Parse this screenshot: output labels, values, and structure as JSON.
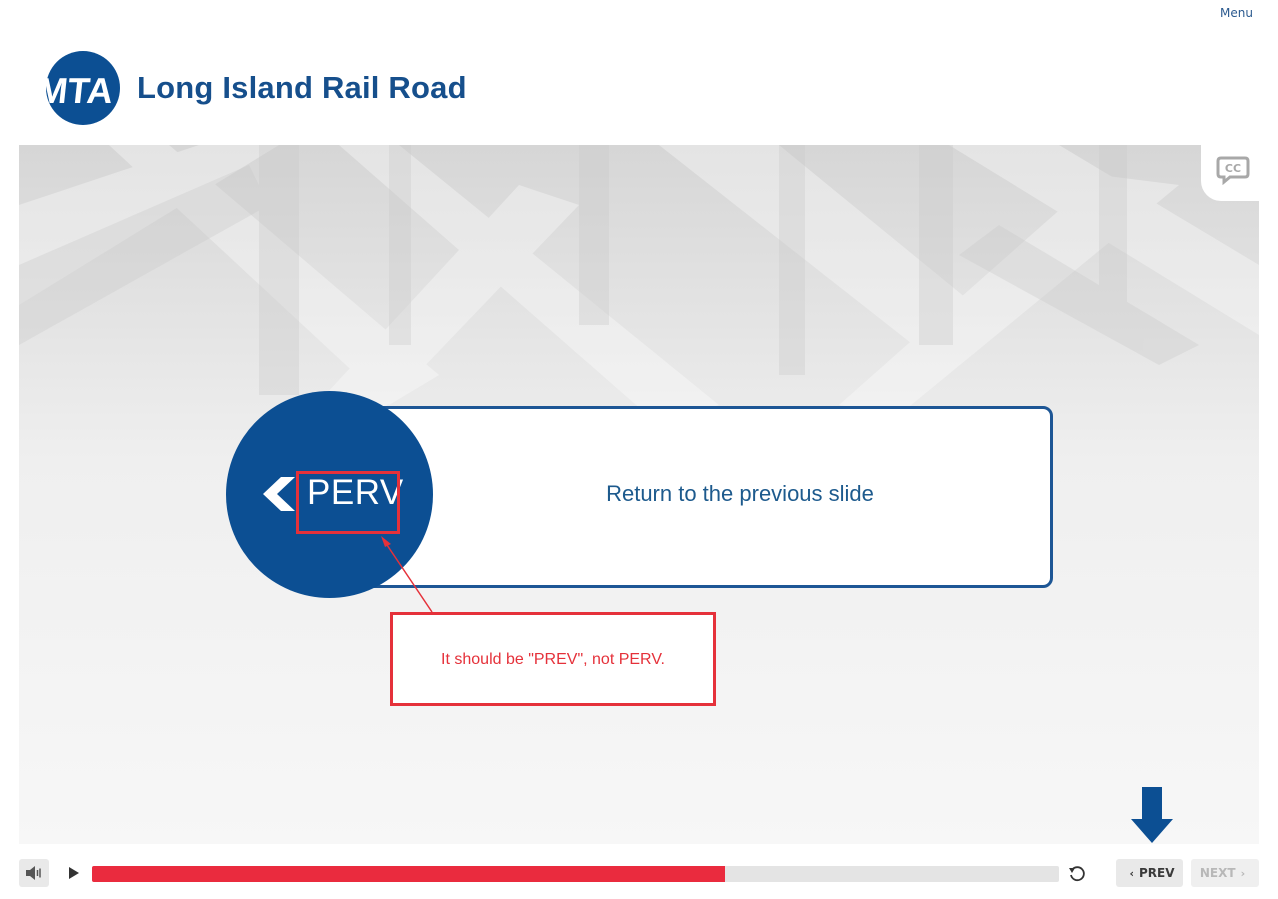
{
  "header": {
    "menu_label": "Menu",
    "logo_text": "MTA",
    "title": "Long Island Rail Road"
  },
  "stage": {
    "cc_icon": "closed-captions-icon",
    "button_label": "PERV",
    "description": "Return to the previous slide",
    "callout_text": "It should be \"PREV\", not PERV."
  },
  "controls": {
    "volume_icon": "volume-icon",
    "play_icon": "play-icon",
    "replay_icon": "replay-icon",
    "progress_fraction": 0.655,
    "prev_label": "PREV",
    "next_label": "NEXT"
  },
  "colors": {
    "brand_blue": "#0c4f93",
    "title_blue": "#164f8c",
    "annotation_red": "#e5313a",
    "progress_red": "#ea2b3e"
  }
}
